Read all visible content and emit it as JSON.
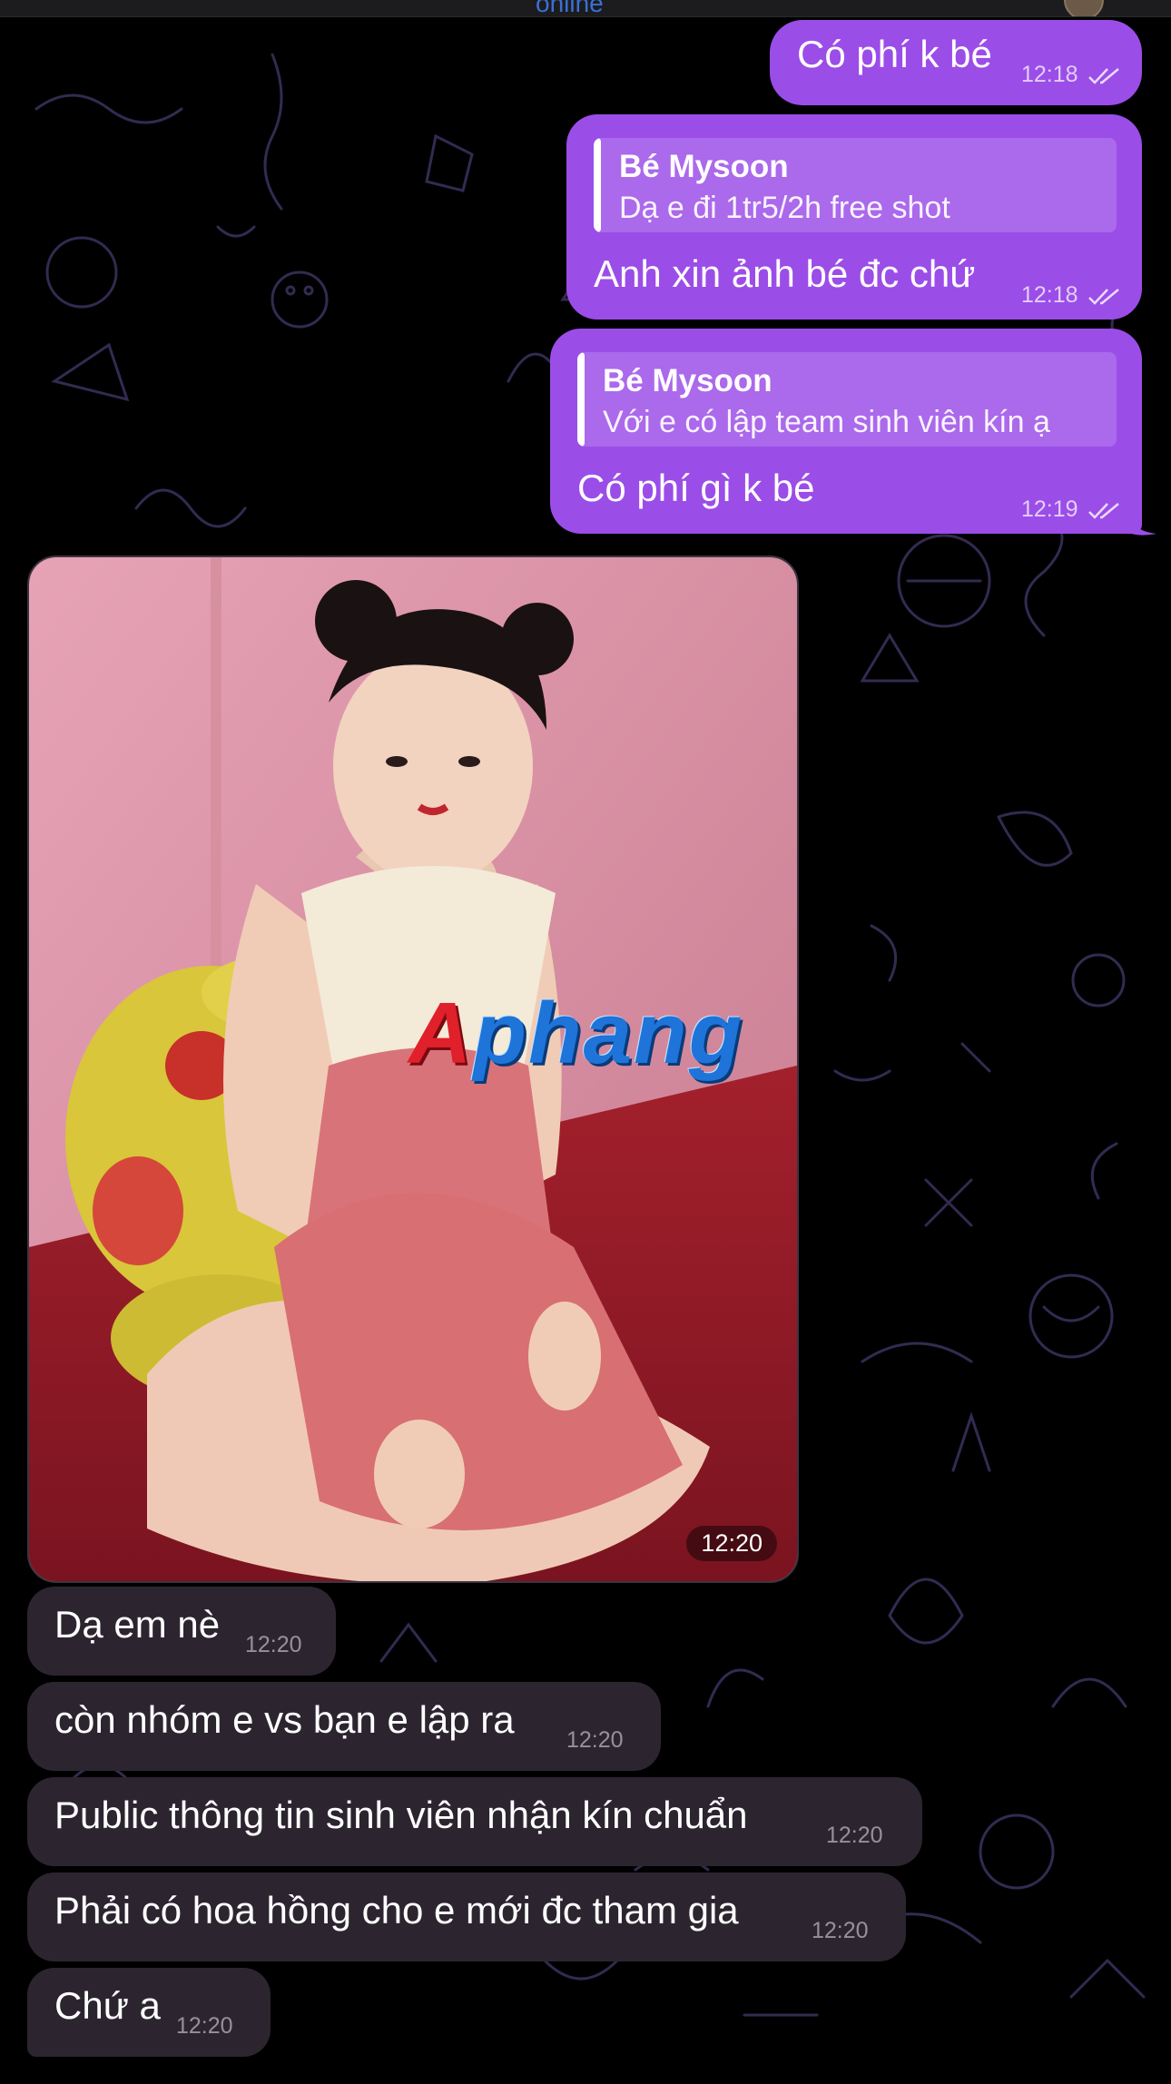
{
  "header": {
    "status_text": "online"
  },
  "colors": {
    "outgoing_bubble": "#9b4de8",
    "incoming_bubble": "#2c2530",
    "background": "#000000",
    "doodle_stroke": "#3a2f5a"
  },
  "messages": {
    "m1": {
      "text": "Có phí k bé",
      "time": "12:18",
      "status": "read-double-check"
    },
    "m2": {
      "reply_name": "Bé Mysoon",
      "reply_text": "Dạ e đi 1tr5/2h free shot",
      "text": "Anh xin ảnh bé đc chứ",
      "time": "12:18",
      "status": "read-double-check"
    },
    "m3": {
      "reply_name": "Bé Mysoon",
      "reply_text": "Với e có lập team sinh viên kín ạ",
      "text": "Có phí gì k bé",
      "time": "12:19",
      "status": "read-double-check"
    },
    "photo": {
      "time": "12:20",
      "watermark": "Aphang"
    },
    "m4": {
      "text": "Dạ em nè",
      "time": "12:20"
    },
    "m5": {
      "text": "còn nhóm e vs bạn e lập ra",
      "time": "12:20"
    },
    "m6": {
      "text": "Public thông tin sinh viên nhận kín chuẩn",
      "time": "12:20"
    },
    "m7": {
      "text": "Phải có hoa hồng cho e mới đc tham gia",
      "time": "12:20"
    },
    "m8": {
      "text": "Chứ a",
      "time": "12:20"
    }
  }
}
